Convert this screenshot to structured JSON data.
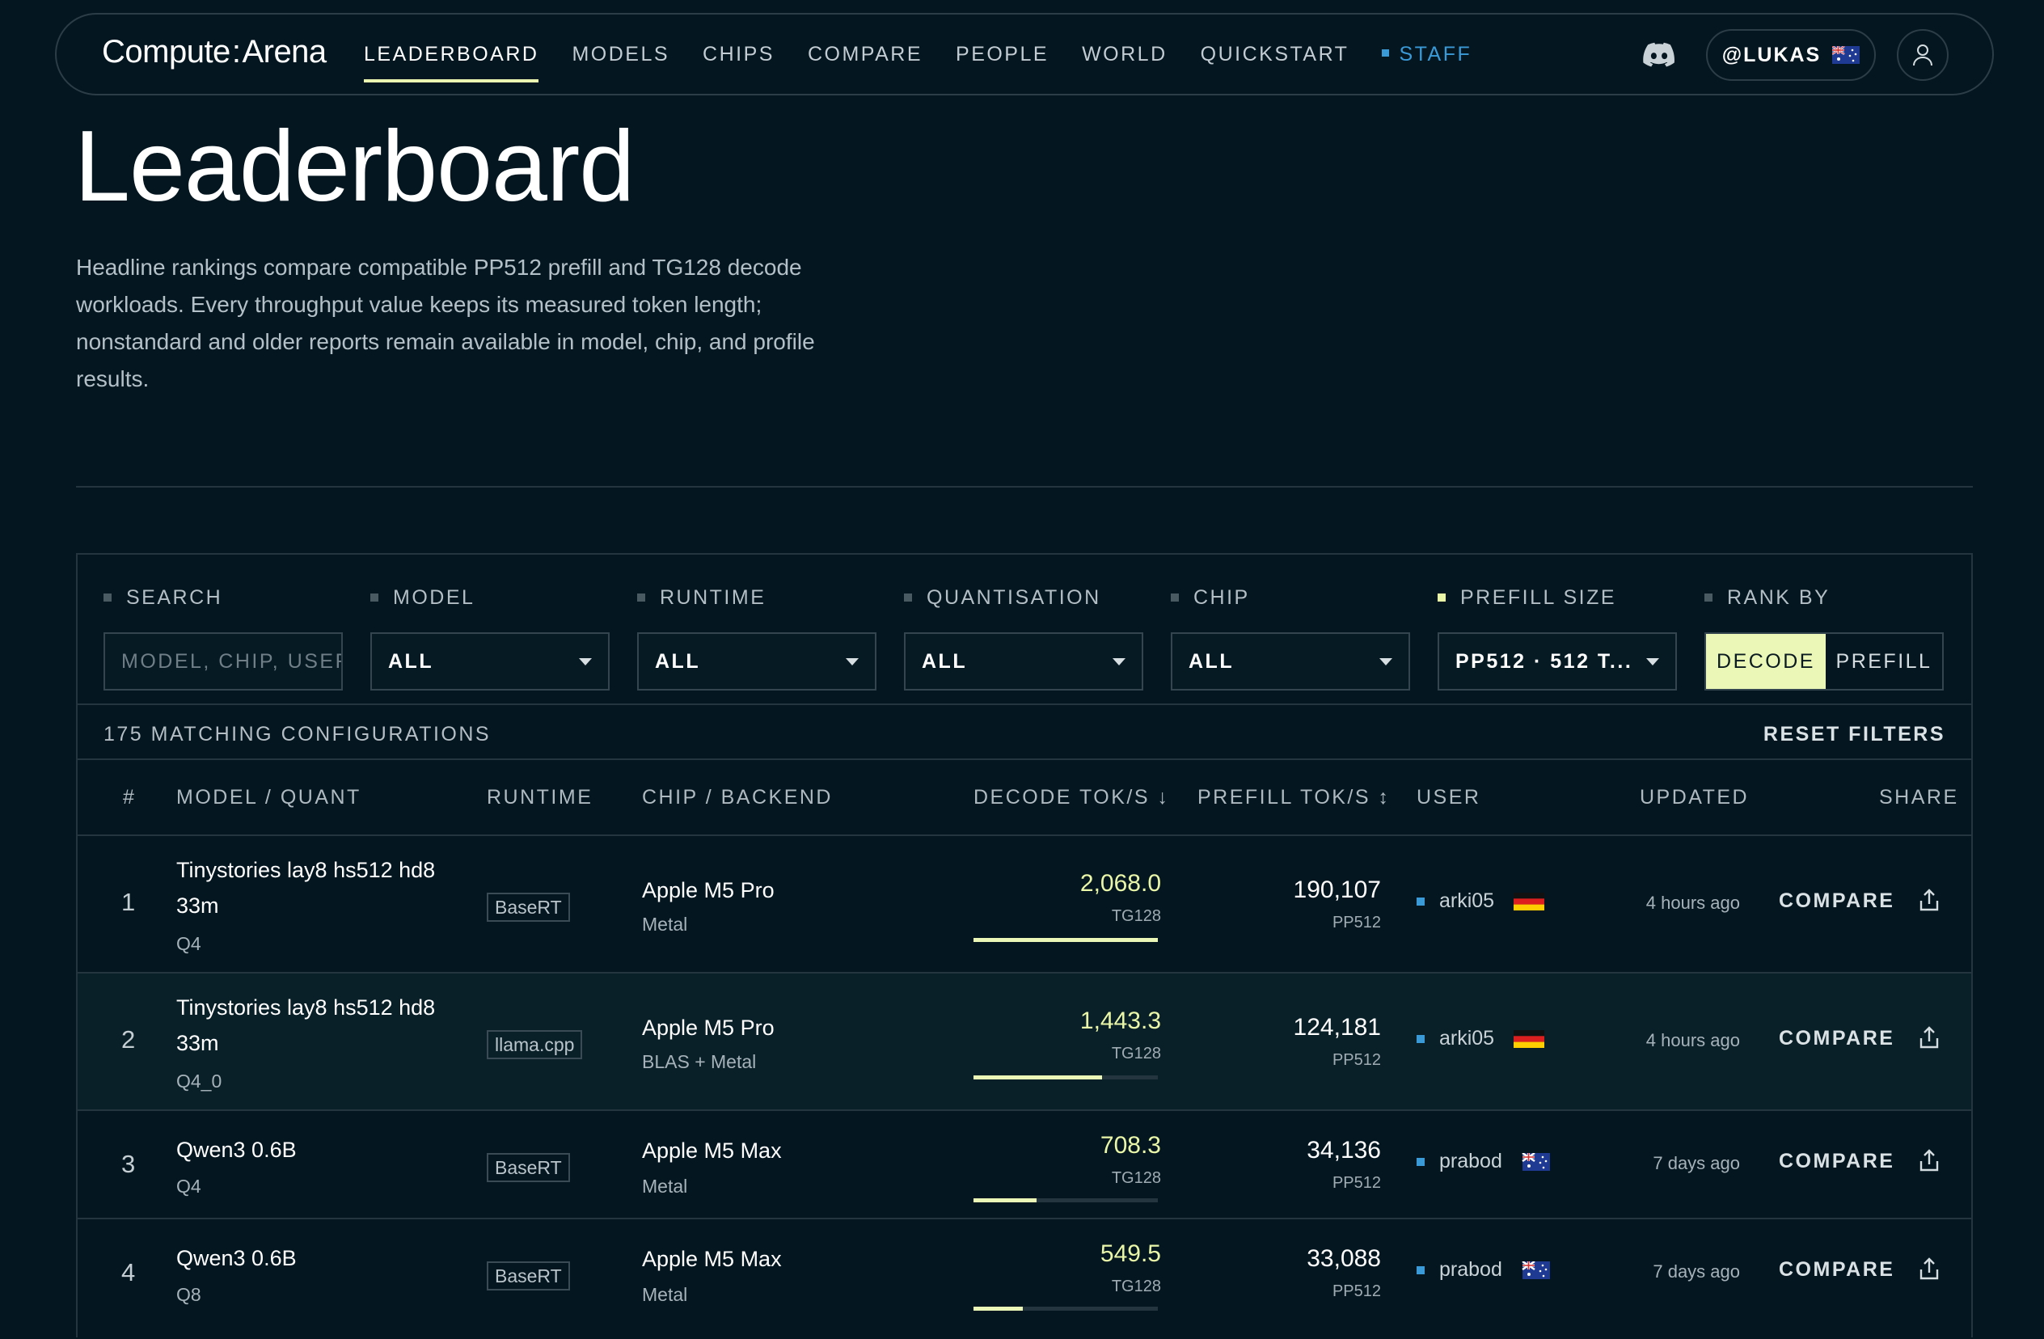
{
  "nav": {
    "logo_a": "Compute",
    "logo_sep": ":",
    "logo_b": "Arena",
    "links": [
      "LEADERBOARD",
      "MODELS",
      "CHIPS",
      "COMPARE",
      "PEOPLE",
      "WORLD",
      "QUICKSTART"
    ],
    "staff": "STAFF",
    "user": "@LUKAS"
  },
  "hero": {
    "title": "Leaderboard",
    "description": "Headline rankings compare compatible PP512 prefill and TG128 decode workloads. Every throughput value keeps its measured token length; nonstandard and older reports remain available in model, chip, and profile results."
  },
  "filters": {
    "search_label": "SEARCH",
    "search_placeholder": "MODEL, CHIP, USER",
    "model_label": "MODEL",
    "model_value": "ALL",
    "runtime_label": "RUNTIME",
    "runtime_value": "ALL",
    "quant_label": "QUANTISATION",
    "quant_value": "ALL",
    "chip_label": "CHIP",
    "chip_value": "ALL",
    "prefill_label": "PREFILL SIZE",
    "prefill_value": "PP512 · 512 T...",
    "rank_label": "RANK BY",
    "rank_decode": "DECODE",
    "rank_prefill": "PREFILL"
  },
  "summary": {
    "count": "175 MATCHING CONFIGURATIONS",
    "reset": "RESET FILTERS"
  },
  "columns": {
    "rank": "#",
    "model": "MODEL / QUANT",
    "runtime": "RUNTIME",
    "chip": "CHIP / BACKEND",
    "decode": "DECODE TOK/S ↓",
    "prefill": "PREFILL TOK/S ↕",
    "user": "USER",
    "updated": "UPDATED",
    "share": "SHARE"
  },
  "rows": [
    {
      "rank": "1",
      "model_1": "Tinystories lay8 hs512 hd8",
      "model_2": "33m",
      "quant": "Q4",
      "runtime": "BaseRT",
      "chip": "Apple M5 Pro",
      "backend": "Metal",
      "decode": "2,068.0",
      "decode_unit": "TG128",
      "decode_fraction": 1.0,
      "prefill": "190,107",
      "prefill_unit": "PP512",
      "user": "arki05",
      "flag": "de",
      "updated": "4 hours ago",
      "compare": "COMPARE"
    },
    {
      "rank": "2",
      "model_1": "Tinystories lay8 hs512 hd8",
      "model_2": "33m",
      "quant": "Q4_0",
      "runtime": "llama.cpp",
      "chip": "Apple M5 Pro",
      "backend": "BLAS + Metal",
      "decode": "1,443.3",
      "decode_unit": "TG128",
      "decode_fraction": 0.698,
      "prefill": "124,181",
      "prefill_unit": "PP512",
      "user": "arki05",
      "flag": "de",
      "updated": "4 hours ago",
      "compare": "COMPARE"
    },
    {
      "rank": "3",
      "model_1": "Qwen3 0.6B",
      "model_2": "",
      "quant": "Q4",
      "runtime": "BaseRT",
      "chip": "Apple M5 Max",
      "backend": "Metal",
      "decode": "708.3",
      "decode_unit": "TG128",
      "decode_fraction": 0.342,
      "prefill": "34,136",
      "prefill_unit": "PP512",
      "user": "prabod",
      "flag": "au",
      "updated": "7 days ago",
      "compare": "COMPARE"
    },
    {
      "rank": "4",
      "model_1": "Qwen3 0.6B",
      "model_2": "",
      "quant": "Q8",
      "runtime": "BaseRT",
      "chip": "Apple M5 Max",
      "backend": "Metal",
      "decode": "549.5",
      "decode_unit": "TG128",
      "decode_fraction": 0.266,
      "prefill": "33,088",
      "prefill_unit": "PP512",
      "user": "prabod",
      "flag": "au",
      "updated": "7 days ago",
      "compare": "COMPARE"
    }
  ],
  "colors": {
    "background": "#041620",
    "accent": "#eaf7b6",
    "staff": "#3a9ad8",
    "border": "#24353f"
  },
  "icons": {
    "discord": "discord-icon",
    "profile": "user-icon",
    "share": "share-icon",
    "dropdown": "chevron-down-icon"
  }
}
